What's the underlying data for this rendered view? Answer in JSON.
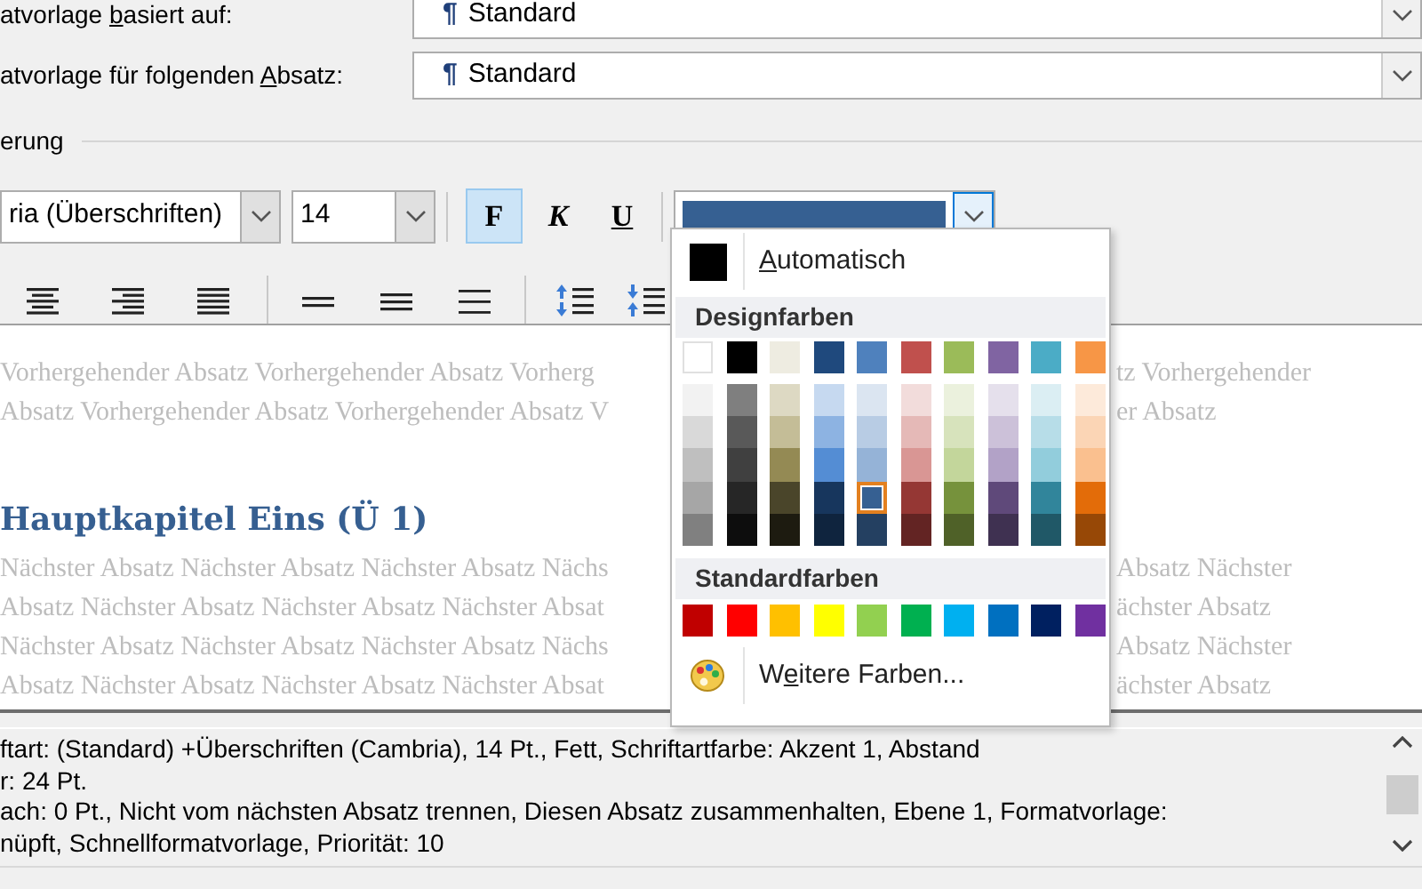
{
  "fields": [
    {
      "label": {
        "before": "atvorlage ",
        "key": "b",
        "after": "asiert auf:"
      },
      "symbol": "¶",
      "value": "Standard"
    },
    {
      "label": {
        "before": "atvorlage für folgenden ",
        "key": "A",
        "after": "bsatz:"
      },
      "symbol": "¶",
      "value": "Standard"
    }
  ],
  "section": {
    "title": "erung"
  },
  "formatting": {
    "font": {
      "value": "ria (Überschriften)"
    },
    "size": {
      "value": "14"
    },
    "styles": [
      {
        "kind": "bold",
        "label": "F",
        "selected": true
      },
      {
        "kind": "italic",
        "label": "K",
        "selected": false
      },
      {
        "kind": "underline",
        "label": "U",
        "selected": false
      }
    ],
    "font_color": {
      "color": "#366092"
    }
  },
  "color_menu": {
    "automatic": {
      "label": {
        "key": "A",
        "after": "utomatisch"
      },
      "color": "#000000"
    },
    "theme_header": "Designfarben",
    "theme_colors": [
      {
        "color": "#ffffff",
        "selected": false
      },
      {
        "color": "#000000",
        "selected": false
      },
      {
        "color": "#eeece1",
        "selected": false
      },
      {
        "color": "#1f497d",
        "selected": false
      },
      {
        "color": "#4f81bd",
        "selected": false
      },
      {
        "color": "#c0504d",
        "selected": false
      },
      {
        "color": "#9bbb59",
        "selected": false
      },
      {
        "color": "#8064a2",
        "selected": false
      },
      {
        "color": "#4bacc6",
        "selected": false
      },
      {
        "color": "#f79646",
        "selected": false
      }
    ],
    "shade_columns": [
      [
        {
          "color": "#f2f2f2",
          "selected": false
        },
        {
          "color": "#d9d9d9",
          "selected": false
        },
        {
          "color": "#bfbfbf",
          "selected": false
        },
        {
          "color": "#a6a6a6",
          "selected": false
        },
        {
          "color": "#808080",
          "selected": false
        }
      ],
      [
        {
          "color": "#7f7f7f",
          "selected": false
        },
        {
          "color": "#595959",
          "selected": false
        },
        {
          "color": "#404040",
          "selected": false
        },
        {
          "color": "#262626",
          "selected": false
        },
        {
          "color": "#0d0d0d",
          "selected": false
        }
      ],
      [
        {
          "color": "#ddd9c3",
          "selected": false
        },
        {
          "color": "#c4bd97",
          "selected": false
        },
        {
          "color": "#948a54",
          "selected": false
        },
        {
          "color": "#4a452a",
          "selected": false
        },
        {
          "color": "#1d1b10",
          "selected": false
        }
      ],
      [
        {
          "color": "#c6d9f0",
          "selected": false
        },
        {
          "color": "#8db3e2",
          "selected": false
        },
        {
          "color": "#548dd4",
          "selected": false
        },
        {
          "color": "#17365d",
          "selected": false
        },
        {
          "color": "#0f243e",
          "selected": false
        }
      ],
      [
        {
          "color": "#dbe5f1",
          "selected": false
        },
        {
          "color": "#b8cce4",
          "selected": false
        },
        {
          "color": "#95b3d7",
          "selected": false
        },
        {
          "color": "#366092",
          "selected": true
        },
        {
          "color": "#244061",
          "selected": false
        }
      ],
      [
        {
          "color": "#f2dcdb",
          "selected": false
        },
        {
          "color": "#e5b9b7",
          "selected": false
        },
        {
          "color": "#d99694",
          "selected": false
        },
        {
          "color": "#953734",
          "selected": false
        },
        {
          "color": "#632423",
          "selected": false
        }
      ],
      [
        {
          "color": "#ebf1dd",
          "selected": false
        },
        {
          "color": "#d7e3bc",
          "selected": false
        },
        {
          "color": "#c3d69b",
          "selected": false
        },
        {
          "color": "#76923c",
          "selected": false
        },
        {
          "color": "#4f6128",
          "selected": false
        }
      ],
      [
        {
          "color": "#e5e0ec",
          "selected": false
        },
        {
          "color": "#ccc1d9",
          "selected": false
        },
        {
          "color": "#b2a2c7",
          "selected": false
        },
        {
          "color": "#5f497a",
          "selected": false
        },
        {
          "color": "#3f3151",
          "selected": false
        }
      ],
      [
        {
          "color": "#dbeef3",
          "selected": false
        },
        {
          "color": "#b7dde8",
          "selected": false
        },
        {
          "color": "#92cddc",
          "selected": false
        },
        {
          "color": "#31859b",
          "selected": false
        },
        {
          "color": "#205867",
          "selected": false
        }
      ],
      [
        {
          "color": "#fdeada",
          "selected": false
        },
        {
          "color": "#fbd5b5",
          "selected": false
        },
        {
          "color": "#fac08f",
          "selected": false
        },
        {
          "color": "#e36c09",
          "selected": false
        },
        {
          "color": "#974806",
          "selected": false
        }
      ]
    ],
    "standard_header": "Standardfarben",
    "standard_colors": [
      {
        "color": "#c00000",
        "selected": false
      },
      {
        "color": "#ff0000",
        "selected": false
      },
      {
        "color": "#ffc000",
        "selected": false
      },
      {
        "color": "#ffff00",
        "selected": false
      },
      {
        "color": "#92d050",
        "selected": false
      },
      {
        "color": "#00b050",
        "selected": false
      },
      {
        "color": "#00b0f0",
        "selected": false
      },
      {
        "color": "#0070c0",
        "selected": false
      },
      {
        "color": "#002060",
        "selected": false
      },
      {
        "color": "#7030a0",
        "selected": false
      }
    ],
    "more": {
      "label": {
        "before": "W",
        "key": "e",
        "after": "itere Farben..."
      }
    }
  },
  "preview": {
    "before_lines": [
      {
        "left": "Vorhergehender Absatz Vorhergehender Absatz Vorherg",
        "right": "tz Vorhergehender"
      },
      {
        "left": "Absatz Vorhergehender Absatz Vorhergehender Absatz V",
        "right": "er Absatz"
      }
    ],
    "heading": "Hauptkapitel Eins (Ü 1)",
    "after_lines": [
      {
        "left": "Nächster Absatz Nächster Absatz Nächster Absatz Nächs",
        "right": "Absatz Nächster"
      },
      {
        "left": "Absatz Nächster Absatz Nächster Absatz Nächster Absat",
        "right": "ächster Absatz"
      },
      {
        "left": "Nächster Absatz Nächster Absatz Nächster Absatz Nächs",
        "right": "Absatz Nächster"
      },
      {
        "left": "Absatz Nächster Absatz Nächster Absatz Nächster Absat",
        "right": "ächster Absatz"
      }
    ]
  },
  "description": {
    "lines": [
      "ftart: (Standard) +Überschriften (Cambria), 14 Pt., Fett, Schriftartfarbe: Akzent 1, Abstand",
      "r:  24 Pt.",
      "ach:  0 Pt., Nicht vom nächsten Absatz trennen, Diesen Absatz zusammenhalten, Ebene 1, Formatvorlage:",
      "nüpft, Schnellformatvorlage, Priorität: 10"
    ]
  }
}
